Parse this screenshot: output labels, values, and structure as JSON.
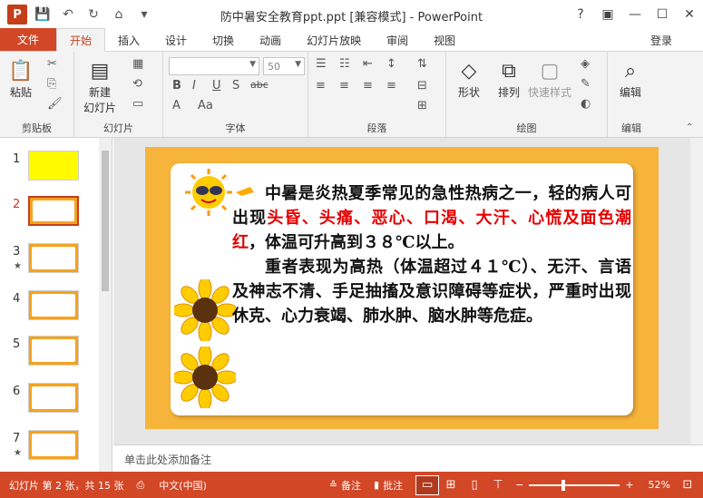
{
  "window": {
    "title": "防中暑安全教育ppt.ppt [兼容模式] - PowerPoint",
    "app_letter": "P",
    "help": "?",
    "ribbon_display": "▣",
    "minimize": "—",
    "maximize": "☐",
    "close": "✕"
  },
  "quick_access": {
    "save": "💾",
    "undo": "↶",
    "redo": "↻",
    "present": "⌂",
    "more": "▾"
  },
  "tabs": [
    "文件",
    "开始",
    "插入",
    "设计",
    "切换",
    "动画",
    "幻灯片放映",
    "审阅",
    "视图"
  ],
  "active_tab": "开始",
  "account": {
    "login": "登录"
  },
  "ribbon": {
    "clipboard": {
      "label": "剪贴板",
      "paste": "粘贴"
    },
    "slides": {
      "label": "幻灯片",
      "new_slide": "新建\n幻灯片"
    },
    "font": {
      "label": "字体",
      "font_name": "",
      "font_size": "50",
      "bold": "B",
      "italic": "I",
      "underline": "U",
      "strike": "S",
      "spacing": "abc",
      "shadow": "S",
      "change_case": "Aa"
    },
    "paragraph": {
      "label": "段落"
    },
    "drawing": {
      "label": "绘图",
      "shapes": "形状",
      "arrange": "排列",
      "quick_styles": "快速样式"
    },
    "editing": {
      "label": "编辑",
      "edit": "编辑"
    }
  },
  "thumbnails": [
    {
      "num": "1",
      "star": ""
    },
    {
      "num": "2",
      "star": ""
    },
    {
      "num": "3",
      "star": "★"
    },
    {
      "num": "4",
      "star": ""
    },
    {
      "num": "5",
      "star": ""
    },
    {
      "num": "6",
      "star": ""
    },
    {
      "num": "7",
      "star": "★"
    }
  ],
  "selected_slide": "2",
  "slide": {
    "para1_a": "中暑是炎热夏季常见的急性热病之一，轻的病人可出现",
    "para1_red": "头昏、头痛、恶心、口渴、大汗、心慌及面色潮红",
    "para1_b": "，体温可升高到３８℃以上。",
    "para2": "重者表现为高热（体温超过４１℃）、无汗、言语及神志不清、手足抽搐及意识障碍等症状，严重时出现休克、心力衰竭、肺水肿、脑水肿等危症。"
  },
  "notes": {
    "placeholder": "单击此处添加备注"
  },
  "status": {
    "slide_info": "幻灯片 第 2 张，共 15 张",
    "language": "中文(中国)",
    "notes_btn": "备注",
    "comments_btn": "批注",
    "zoom_minus": "−",
    "zoom_plus": "+",
    "zoom": "52%"
  },
  "colors": {
    "accent": "#d24726",
    "slide_bg": "#f7b43a",
    "highlight_text": "#e60000"
  }
}
